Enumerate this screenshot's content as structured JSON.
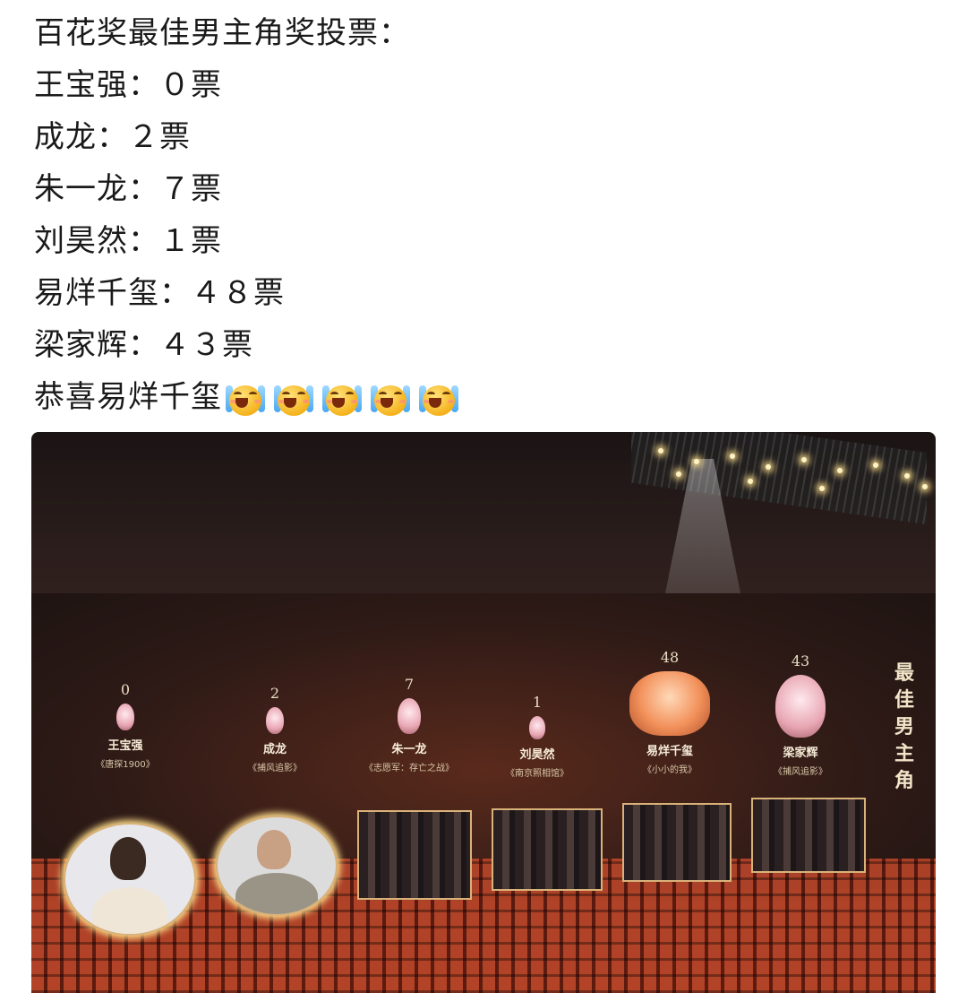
{
  "post": {
    "title": "百花奖最佳男主角奖投票：",
    "votes": [
      {
        "text": "王宝强：０票"
      },
      {
        "text": "成龙：２票"
      },
      {
        "text": "朱一龙：７票"
      },
      {
        "text": "刘昊然：１票"
      },
      {
        "text": "易烊千玺：４８票"
      },
      {
        "text": "梁家辉：４３票"
      }
    ],
    "closing": "恭喜易烊千玺",
    "emoji_icon": "crying-laughing-emoji-icon",
    "emoji_count": 5
  },
  "photo": {
    "side_title": "最佳男主角",
    "candidates": [
      {
        "votes": "0",
        "name": "王宝强",
        "film": "《唐探1900》"
      },
      {
        "votes": "2",
        "name": "成龙",
        "film": "《捕风追影》"
      },
      {
        "votes": "7",
        "name": "朱一龙",
        "film": "《志愿军：存亡之战》"
      },
      {
        "votes": "1",
        "name": "刘昊然",
        "film": "《南京照相馆》"
      },
      {
        "votes": "48",
        "name": "易烊千玺",
        "film": "《小小的我》"
      },
      {
        "votes": "43",
        "name": "梁家辉",
        "film": "《捕风追影》"
      }
    ]
  }
}
